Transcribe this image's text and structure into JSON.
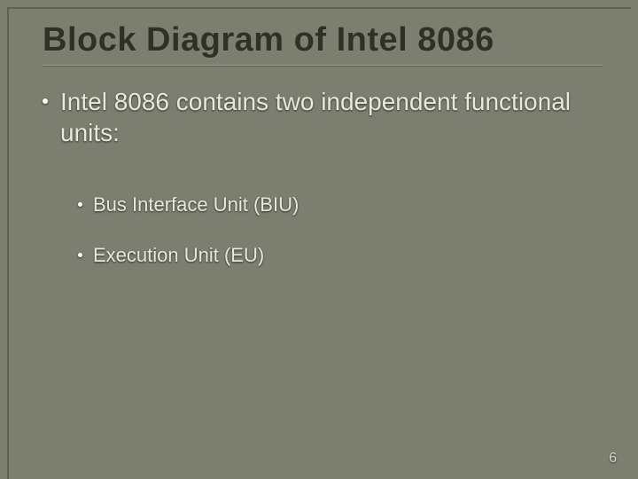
{
  "title": "Block Diagram of Intel 8086",
  "main_bullet": "Intel 8086 contains two independent functional units:",
  "sub_bullets": [
    "Bus Interface Unit (BIU)",
    "Execution Unit (EU)"
  ],
  "page_number": "6"
}
